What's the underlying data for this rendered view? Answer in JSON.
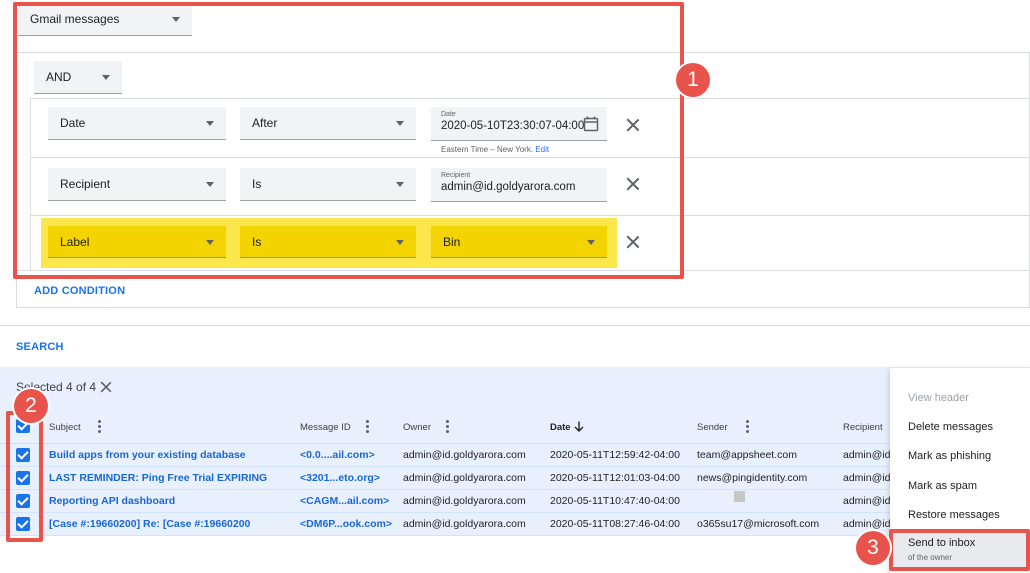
{
  "source_select": {
    "value": "Gmail messages"
  },
  "operator_select": {
    "value": "AND"
  },
  "conditions": [
    {
      "field": "Date",
      "op": "After",
      "value_label": "Date",
      "value": "2020-05-10T23:30:07-04:00",
      "helper": "Eastern Time – New York.",
      "helper_link": "Edit"
    },
    {
      "field": "Recipient",
      "op": "Is",
      "value_label": "Recipient",
      "value": "admin@id.goldyarora.com"
    },
    {
      "field": "Label",
      "op": "Is",
      "value": "Bin"
    }
  ],
  "add_condition_label": "ADD CONDITION",
  "search_label": "SEARCH",
  "selection": {
    "text": "Selected 4 of 4"
  },
  "table": {
    "headers": {
      "subject": "Subject",
      "message_id": "Message ID",
      "owner": "Owner",
      "date": "Date",
      "sender": "Sender",
      "recipient": "Recipient"
    },
    "rows": [
      {
        "subject": "Build apps from your existing database",
        "message_id": "<0.0....ail.com>",
        "owner": "admin@id.goldyarora.com",
        "date": "2020-05-11T12:59:42-04:00",
        "sender": "team@appsheet.com",
        "recipient": "admin@id.g"
      },
      {
        "subject": "LAST REMINDER: Ping Free Trial EXPIRING",
        "message_id": "<3201...eto.org>",
        "owner": "admin@id.goldyarora.com",
        "date": "2020-05-11T12:01:03-04:00",
        "sender": "news@pingidentity.com",
        "recipient": "admin@id.g"
      },
      {
        "subject": "Reporting API dashboard",
        "message_id": "<CAGM...ail.com>",
        "owner": "admin@id.goldyarora.com",
        "date": "2020-05-11T10:47:40-04:00",
        "sender": "",
        "recipient": "admin@id.g"
      },
      {
        "subject": "[Case #:19660200] Re: [Case #:19660200",
        "message_id": "<DM6P...ook.com>",
        "owner": "admin@id.goldyarora.com",
        "date": "2020-05-11T08:27:46-04:00",
        "sender": "o365su17@microsoft.com",
        "recipient": "admin@id.g"
      }
    ]
  },
  "menu": {
    "items": [
      "View header",
      "Delete messages",
      "Mark as phishing",
      "Mark as spam",
      "Restore messages",
      "Send to inbox"
    ],
    "send_sub": "of the owner"
  },
  "annotations": {
    "badge1": "1",
    "badge2": "2",
    "badge3": "3"
  },
  "colors": {
    "accent": "#1a73e8",
    "highlight": "#f4d400",
    "annotation": "#e8544b",
    "selected_row": "#e8f0fe"
  },
  "icons": {
    "calendar": "calendar-icon",
    "remove": "close-icon",
    "sort": "arrow-down-icon",
    "more": "more-vert-icon",
    "clear": "close-icon"
  }
}
